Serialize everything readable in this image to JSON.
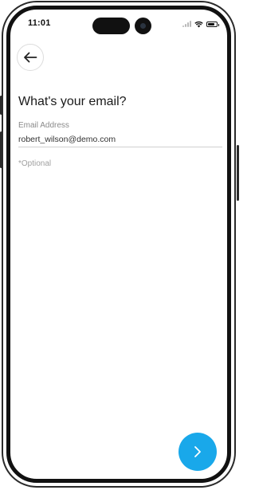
{
  "status_bar": {
    "time": "11:01"
  },
  "header": {
    "back_icon": "arrow-left-icon"
  },
  "main": {
    "title": "What's your email?",
    "email_field": {
      "label": "Email Address",
      "value": "robert_wilson@demo.com"
    },
    "optional_note": "*Optional"
  },
  "footer": {
    "next_icon": "chevron-right-icon"
  },
  "colors": {
    "accent": "#19a8ea",
    "text": "#1a1a1a",
    "muted": "#8a8a8a"
  }
}
